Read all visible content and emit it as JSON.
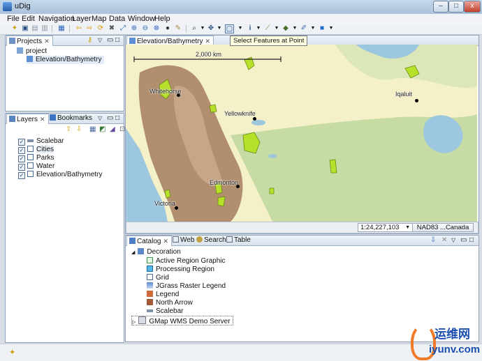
{
  "window": {
    "title": "uDig",
    "minimize": "–",
    "maximize": "□",
    "close": "x"
  },
  "menubar": {
    "items": [
      "File",
      "Edit",
      "Navigation",
      "Layer",
      "Map",
      "Data",
      "Window",
      "Help"
    ]
  },
  "toolbar": {
    "tooltip": "Select Features at Point"
  },
  "projects": {
    "tab_label": "Projects",
    "project_name": "project",
    "map_item": "Elevation/Bathymetry"
  },
  "layers": {
    "tab_label": "Layers",
    "bookmarks_tab_label": "Bookmarks",
    "items": [
      {
        "label": "Scalebar",
        "checked": true
      },
      {
        "label": "Cities",
        "checked": true
      },
      {
        "label": "Parks",
        "checked": true
      },
      {
        "label": "Water",
        "checked": true
      },
      {
        "label": "Elevation/Bathymetry",
        "checked": true
      }
    ]
  },
  "map": {
    "tab_label": "Elevation/Bathymetry",
    "scalebar_label": "2,000 km",
    "cities": [
      {
        "name": "Whitehorse"
      },
      {
        "name": "Yellowknife"
      },
      {
        "name": "Iqaluit"
      },
      {
        "name": "Edmonton"
      },
      {
        "name": "Victoria"
      }
    ],
    "colors": {
      "ocean": "#9dc6df",
      "lowland": "#f4f0c8",
      "forest": "#c6dca4",
      "mountain": "#b08e6e",
      "park": "#b6e02a"
    }
  },
  "statusbar": {
    "scale": "1:24,227,103",
    "crs": "NAD83 ...Canada"
  },
  "catalog": {
    "tabs": [
      "Catalog",
      "Web",
      "Search",
      "Table"
    ],
    "root": "Decoration",
    "items": [
      "Active Region Graphic",
      "Processing Region",
      "Grid",
      "JGrass Raster Legend",
      "Legend",
      "North Arrow",
      "Scalebar"
    ],
    "server": "GMap WMS Demo Server"
  },
  "watermark": {
    "text": "运维网",
    "url": "iyunv.com"
  }
}
